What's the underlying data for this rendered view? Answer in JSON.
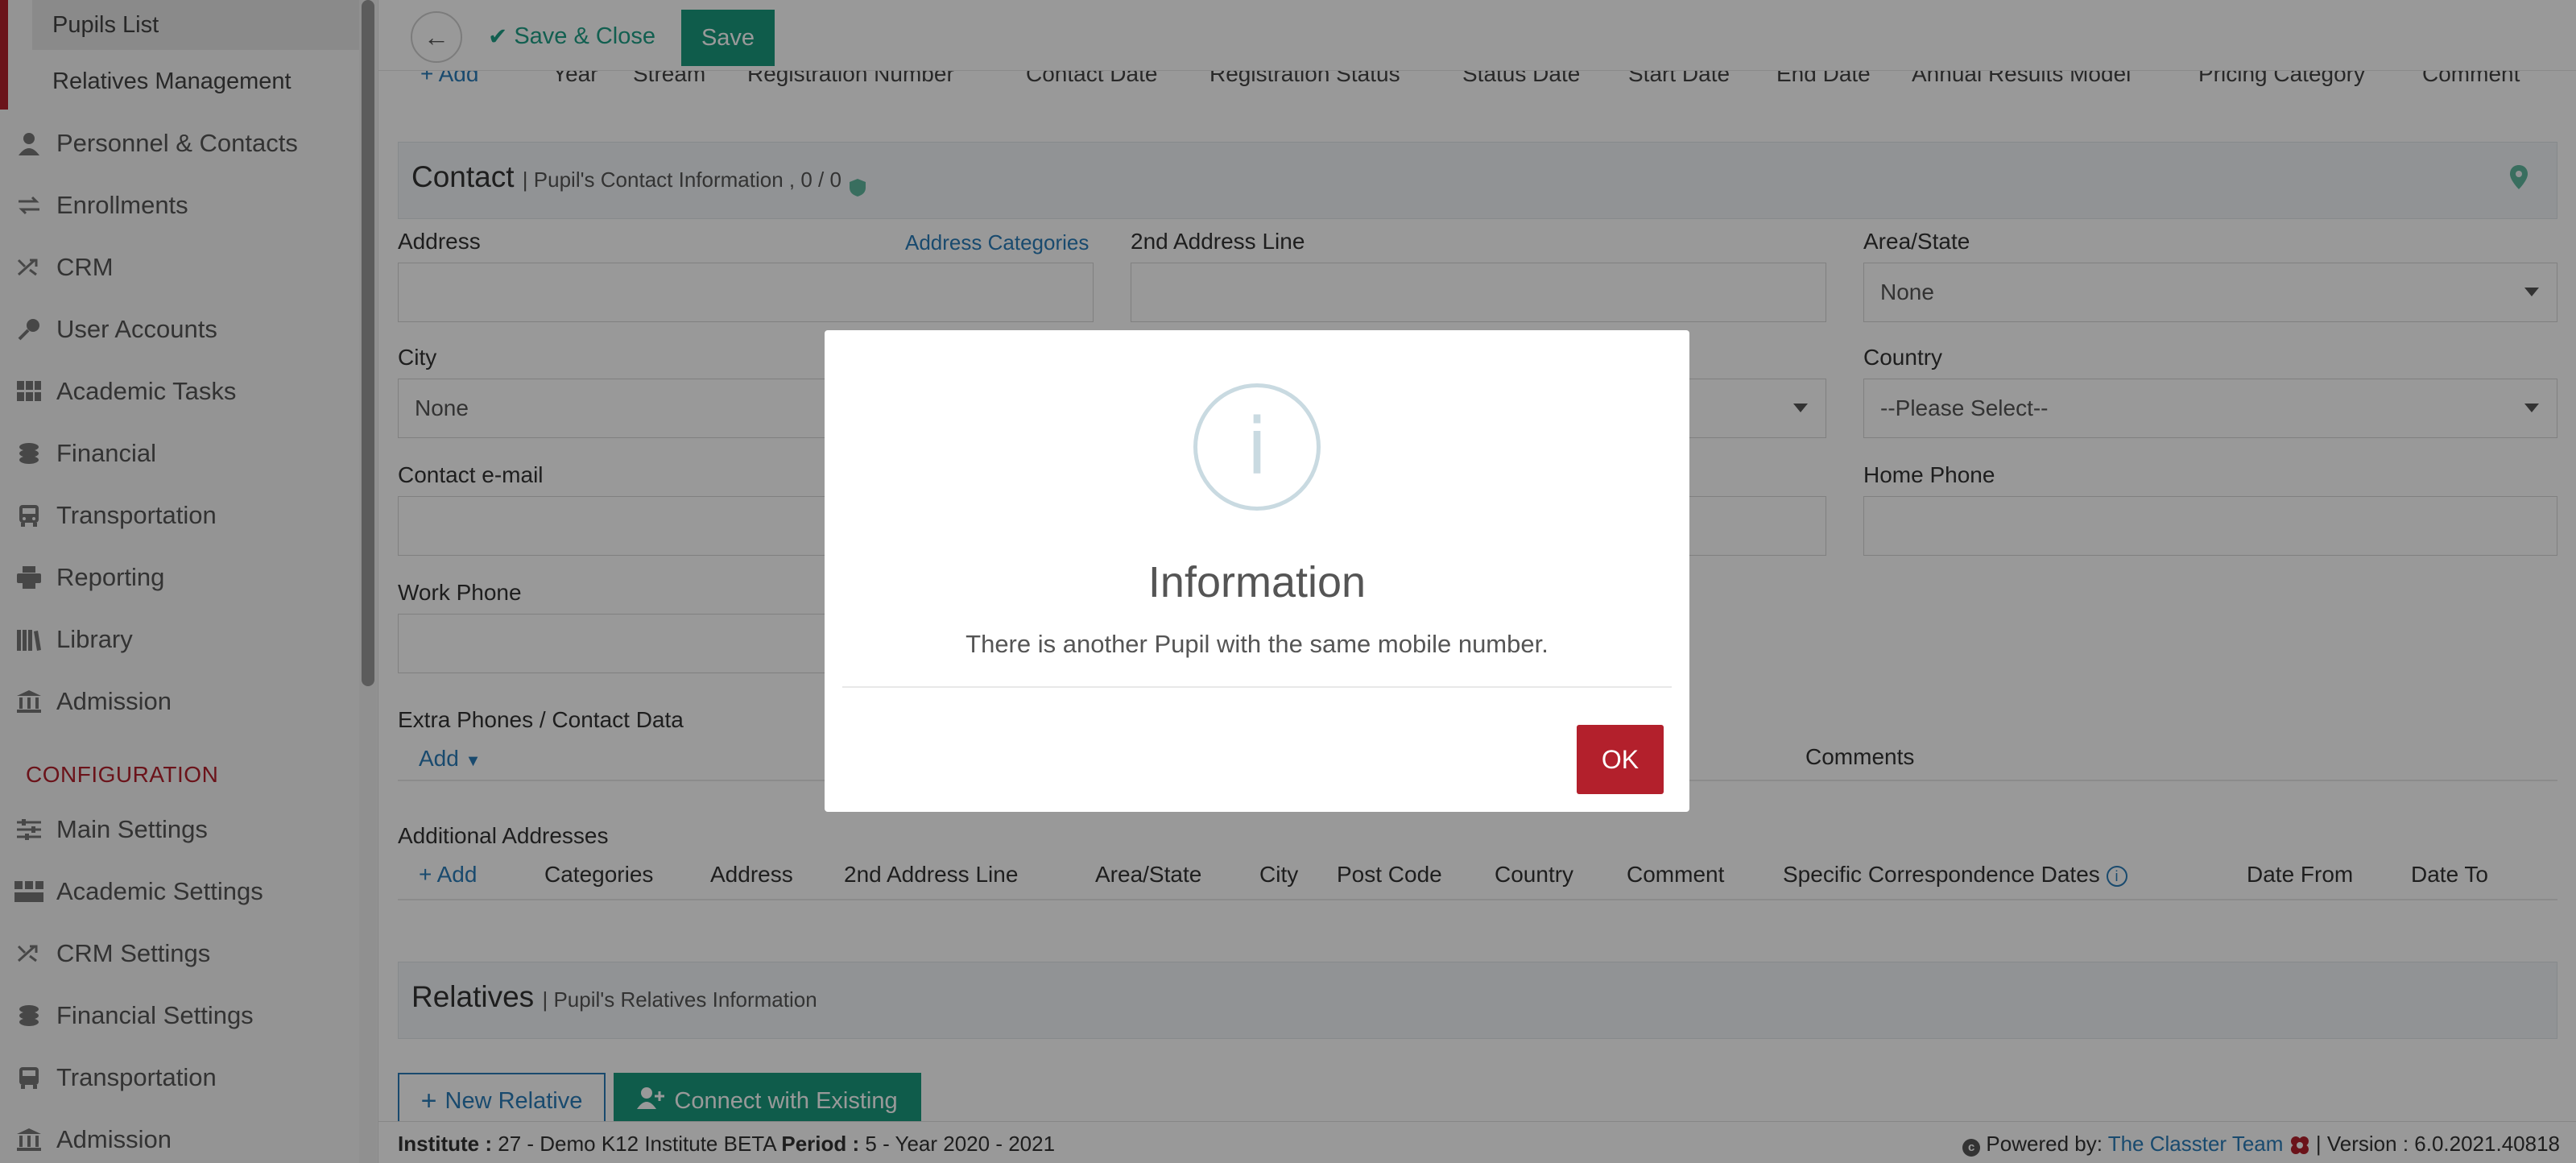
{
  "sidebar": {
    "sub_items": [
      "Pupils List",
      "Relatives Management"
    ],
    "nav_items": [
      {
        "label": "Personnel & Contacts",
        "icon": "person-icon",
        "chevron": false
      },
      {
        "label": "Enrollments",
        "icon": "exchange-icon",
        "chevron": true
      },
      {
        "label": "CRM",
        "icon": "shuffle-icon",
        "chevron": true
      },
      {
        "label": "User Accounts",
        "icon": "key-icon",
        "chevron": false
      },
      {
        "label": "Academic Tasks",
        "icon": "grid-icon",
        "chevron": true
      },
      {
        "label": "Financial",
        "icon": "coins-icon",
        "chevron": true
      },
      {
        "label": "Transportation",
        "icon": "bus-icon",
        "chevron": true
      },
      {
        "label": "Reporting",
        "icon": "printer-icon",
        "chevron": true
      },
      {
        "label": "Library",
        "icon": "books-icon",
        "chevron": true
      },
      {
        "label": "Admission",
        "icon": "institution-icon",
        "chevron": true
      }
    ],
    "config_title": "CONFIGURATION",
    "config_items": [
      {
        "label": "Main Settings",
        "icon": "sliders-icon"
      },
      {
        "label": "Academic Settings",
        "icon": "users-icon"
      },
      {
        "label": "CRM Settings",
        "icon": "shuffle-icon"
      },
      {
        "label": "Financial Settings",
        "icon": "coins-icon"
      },
      {
        "label": "Transportation",
        "icon": "bus-icon"
      },
      {
        "label": "Admission",
        "icon": "institution-icon"
      }
    ]
  },
  "toolbar": {
    "save_close_label": "Save & Close",
    "save_label": "Save"
  },
  "enrollment_table": {
    "add_label": "Add",
    "columns": [
      "Year",
      "Stream",
      "Registration Number",
      "Contact Date",
      "Registration Status",
      "Status Date",
      "Start Date",
      "End Date",
      "Annual Results Model",
      "Pricing Category",
      "Comment"
    ]
  },
  "contact": {
    "title": "Contact",
    "subtitle": "| Pupil's Contact Information , 0 / 0",
    "address_label": "Address",
    "address_categories_link": "Address Categories",
    "address2_label": "2nd Address Line",
    "area_label": "Area/State",
    "area_value": "None",
    "city_label": "City",
    "city_value": "None",
    "country_label": "Country",
    "country_value": "--Please Select--",
    "email_label": "Contact e-mail",
    "home_phone_label": "Home Phone",
    "work_phone_label": "Work Phone"
  },
  "extra_phones": {
    "title": "Extra Phones / Contact Data",
    "add_label": "Add",
    "comments_label": "Comments"
  },
  "additional_addresses": {
    "title": "Additional Addresses",
    "add_label": "Add",
    "columns": [
      "Categories",
      "Address",
      "2nd Address Line",
      "Area/State",
      "City",
      "Post Code",
      "Country",
      "Comment",
      "Specific Correspondence Dates",
      "Date From",
      "Date To"
    ]
  },
  "relatives": {
    "title": "Relatives",
    "subtitle": "| Pupil's Relatives Information",
    "new_relative_label": "New Relative",
    "connect_label": "Connect with Existing"
  },
  "footer": {
    "institute_label": "Institute :",
    "institute_value": "27 - Demo K12 Institute BETA",
    "period_label": "Period :",
    "period_value": "5 - Year 2020 - 2021",
    "powered_by": "Powered by:",
    "team_link": "The Classter Team",
    "version": "| Version : 6.0.2021.40818"
  },
  "modal": {
    "icon": "info-icon",
    "title": "Information",
    "message": "There is another Pupil with the same mobile number.",
    "ok_label": "OK"
  },
  "colors": {
    "accent_green": "#1a9a7e",
    "brand_red": "#b3202c",
    "link_blue": "#2b7cb8"
  }
}
